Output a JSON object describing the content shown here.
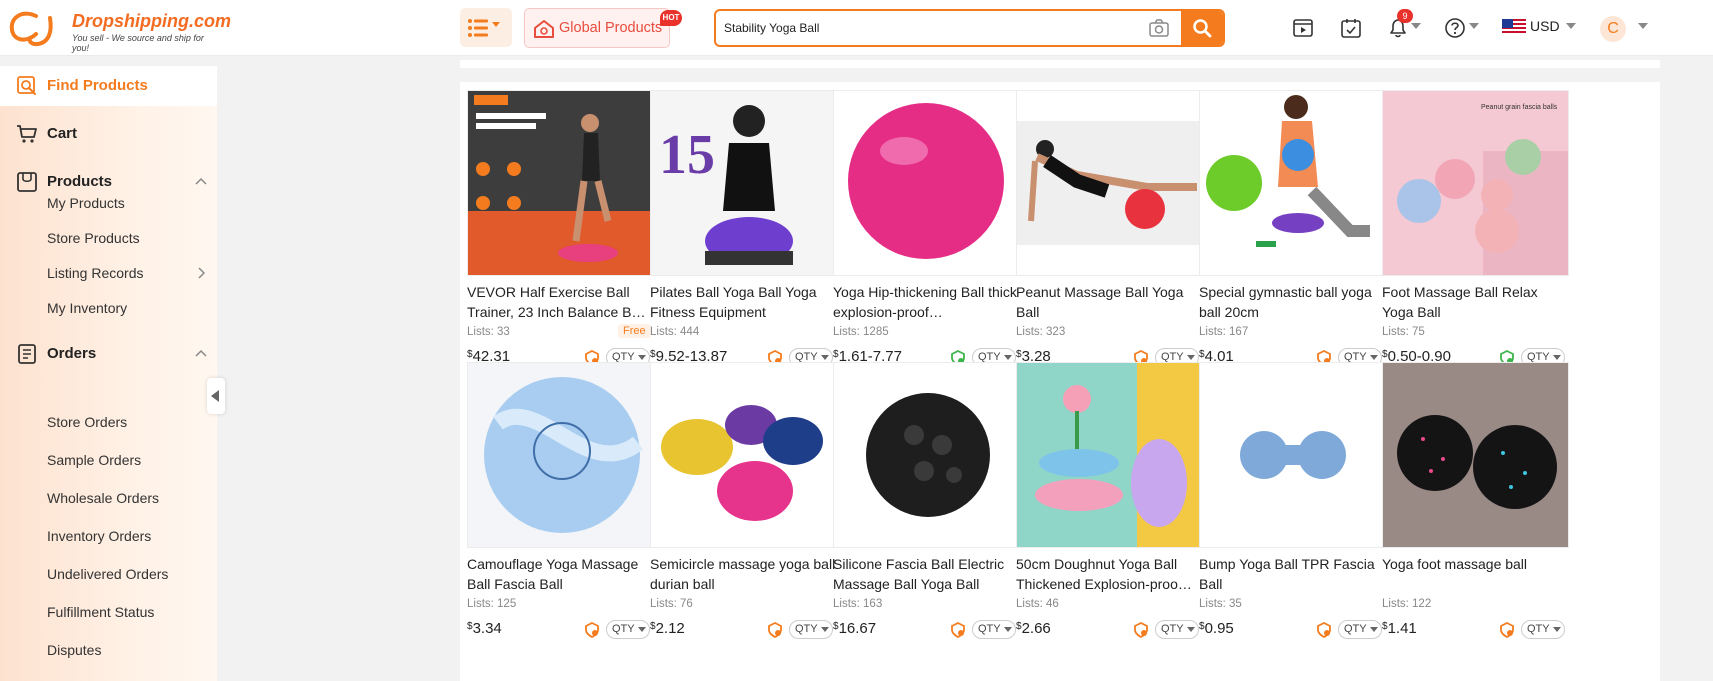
{
  "brand": {
    "name": "Dropshipping.com",
    "tagline": "You sell - We source and ship for you!",
    "accent": "#f47c1e"
  },
  "header": {
    "global_products_label": "Global Products",
    "hot_badge": "HOT",
    "search": {
      "value": "Stability Yoga Ball",
      "placeholder": ""
    },
    "notifications_count": "9",
    "currency": "USD",
    "avatar_initial": "C"
  },
  "sidebar": {
    "find_products": "Find Products",
    "cart": "Cart",
    "products": {
      "label": "Products",
      "items": [
        "My Products",
        "Store Products",
        "Listing Records",
        "My Inventory"
      ]
    },
    "orders": {
      "label": "Orders",
      "items": [
        "Store Orders",
        "Sample Orders",
        "Wholesale Orders",
        "Inventory Orders",
        "Undelivered Orders",
        "Fulfillment Status",
        "Disputes"
      ]
    }
  },
  "products": [
    {
      "title": "VEVOR Half Exercise Ball Trainer, 23 Inch Balance B…",
      "lists": "Lists: 33",
      "price": "42.31",
      "currency_symbol": "$",
      "free": "Free",
      "qty": "QTY",
      "shield": "orange",
      "image": "vevor-half-ball"
    },
    {
      "title": "Pilates Ball Yoga Ball Yoga Fitness Equipment",
      "lists": "Lists: 444",
      "price": "9.52-13.87",
      "currency_symbol": "$",
      "qty": "QTY",
      "shield": "orange",
      "image": "pilates-ball"
    },
    {
      "title": "Yoga Hip-thickening Ball thick explosion-proof…",
      "lists": "Lists: 1285",
      "price": "1.61-7.77",
      "currency_symbol": "$",
      "qty": "QTY",
      "shield": "green",
      "image": "pink-yoga-ball"
    },
    {
      "title": "Peanut Massage Ball Yoga Ball",
      "lists": "Lists: 323",
      "price": "3.28",
      "currency_symbol": "$",
      "qty": "QTY",
      "shield": "orange",
      "image": "peanut-ball"
    },
    {
      "title": "Special gymnastic ball yoga ball 20cm",
      "lists": "Lists: 167",
      "price": "4.01",
      "currency_symbol": "$",
      "qty": "QTY",
      "shield": "orange",
      "image": "gymnastic-ball"
    },
    {
      "title": "Foot Massage Ball Relax Yoga Ball",
      "lists": "Lists: 75",
      "price": "0.50-0.90",
      "currency_symbol": "$",
      "qty": "QTY",
      "shield": "green",
      "image": "foot-massage-ball",
      "image_text": "Peanut grain fascia balls"
    },
    {
      "title": "Camouflage Yoga Massage Ball Fascia Ball",
      "lists": "Lists: 125",
      "price": "3.34",
      "currency_symbol": "$",
      "qty": "QTY",
      "shield": "orange",
      "image": "camouflage-ball"
    },
    {
      "title": "Semicircle massage yoga ball durian ball",
      "lists": "Lists: 76",
      "price": "2.12",
      "currency_symbol": "$",
      "qty": "QTY",
      "shield": "orange",
      "image": "semicircle-balls"
    },
    {
      "title": "Silicone Fascia Ball Electric Massage Ball Yoga Ball",
      "lists": "Lists: 163",
      "price": "16.67",
      "currency_symbol": "$",
      "qty": "QTY",
      "shield": "orange",
      "image": "black-electric-ball"
    },
    {
      "title": "50cm Doughnut Yoga Ball Thickened Explosion-proo…",
      "lists": "Lists: 46",
      "price": "2.66",
      "currency_symbol": "$",
      "qty": "QTY",
      "shield": "orange",
      "image": "doughnut-balls"
    },
    {
      "title": "Bump Yoga Ball TPR Fascia Ball",
      "lists": "Lists: 35",
      "price": "0.95",
      "currency_symbol": "$",
      "qty": "QTY",
      "shield": "orange",
      "image": "blue-peanut-ball"
    },
    {
      "title": "Yoga foot massage ball",
      "lists": "Lists: 122",
      "price": "1.41",
      "currency_symbol": "$",
      "qty": "QTY",
      "shield": "orange",
      "image": "speckled-balls"
    }
  ]
}
